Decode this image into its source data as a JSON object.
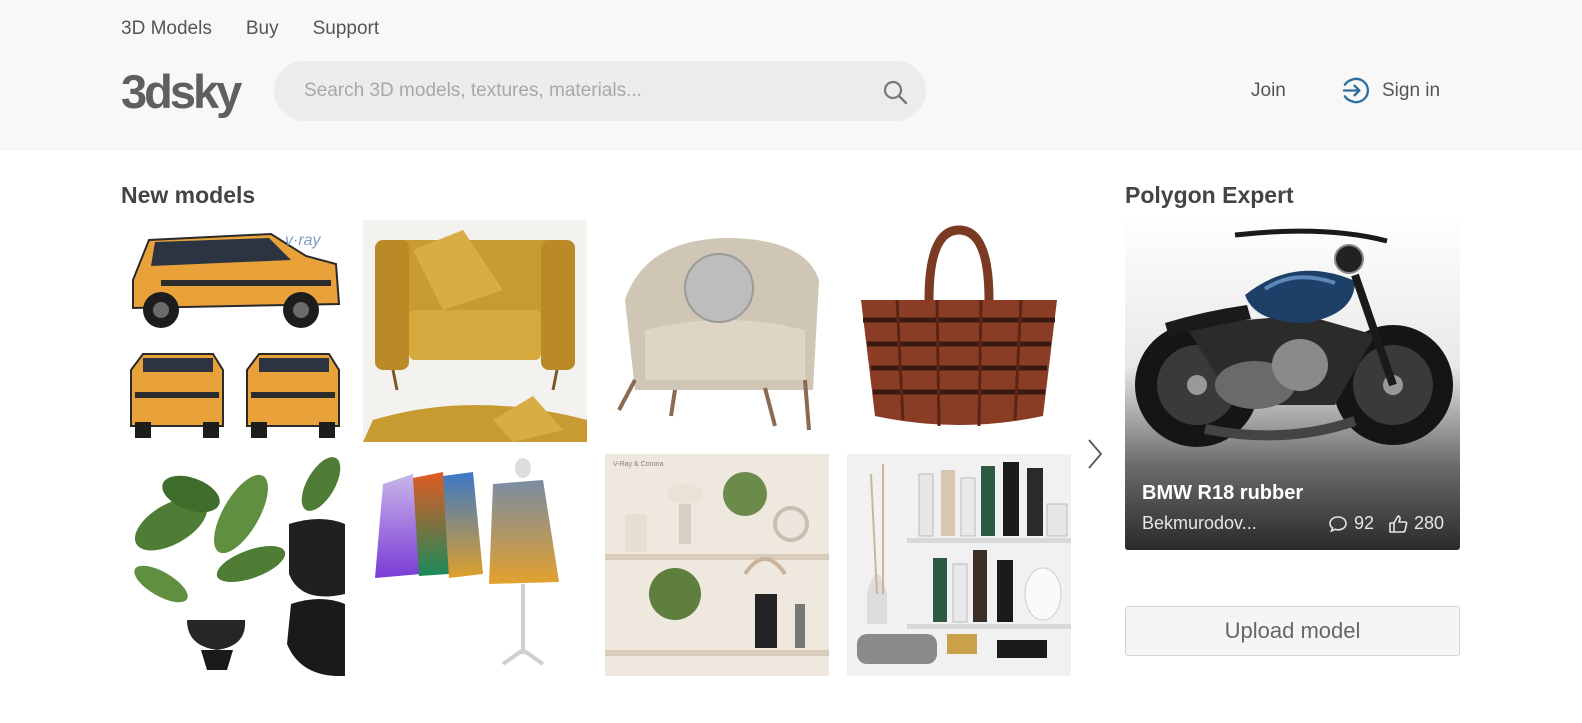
{
  "topnav": [
    "3D Models",
    "Buy",
    "Support"
  ],
  "logo": {
    "text": "3dsky"
  },
  "search": {
    "placeholder": "Search 3D models, textures, materials..."
  },
  "auth": {
    "join": "Join",
    "signin": "Sign in"
  },
  "new_models": {
    "title": "New models",
    "items": [
      {
        "name": "Orange SUV",
        "badge": "v·ray"
      },
      {
        "name": "Mustard armchair"
      },
      {
        "name": "Beige armchair"
      },
      {
        "name": "Leather basket bag"
      },
      {
        "name": "Plant in black pot"
      },
      {
        "name": "Gradient sweaters on hangers"
      },
      {
        "name": "Decor shelf set",
        "caption": "V-Ray & Corona"
      },
      {
        "name": "Bathroom cosmetics shelf"
      }
    ]
  },
  "expert": {
    "title": "Polygon Expert",
    "model_title": "BMW R18 rubber",
    "author": "Bekmurodov...",
    "comments": "92",
    "likes": "280"
  },
  "upload": {
    "label": "Upload model"
  },
  "colors": {
    "accent": "#2f6f9f",
    "header_bg": "#f8f8f8"
  }
}
